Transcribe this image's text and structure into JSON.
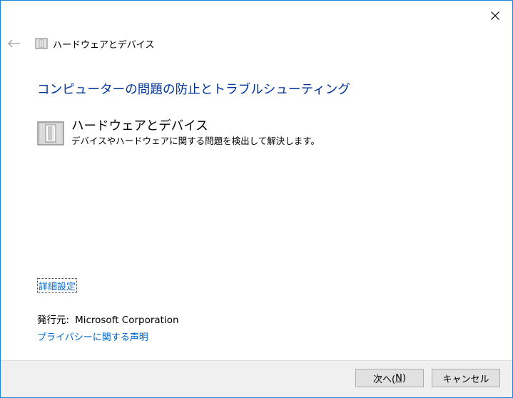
{
  "window": {
    "close_label": "✕"
  },
  "nav": {
    "breadcrumb": "ハードウェアとデバイス"
  },
  "main": {
    "heading": "コンピューターの問題の防止とトラブルシューティング",
    "item": {
      "title": "ハードウェアとデバイス",
      "description": "デバイスやハードウェアに関する問題を検出して解決します。"
    },
    "advanced_link": "詳細設定",
    "publisher_label": "発行元:",
    "publisher_name": "Microsoft Corporation",
    "privacy_link": "プライバシーに関する声明"
  },
  "footer": {
    "next_label_prefix": "次へ(",
    "next_accel": "N",
    "next_label_suffix": ")",
    "cancel_label": "キャンセル"
  },
  "colors": {
    "border": "#1883d7",
    "heading": "#003399",
    "link": "#0066cc",
    "footer_bg": "#f0f0f0"
  },
  "icons": [
    "close-icon",
    "back-arrow-icon",
    "troubleshooter-icon"
  ]
}
